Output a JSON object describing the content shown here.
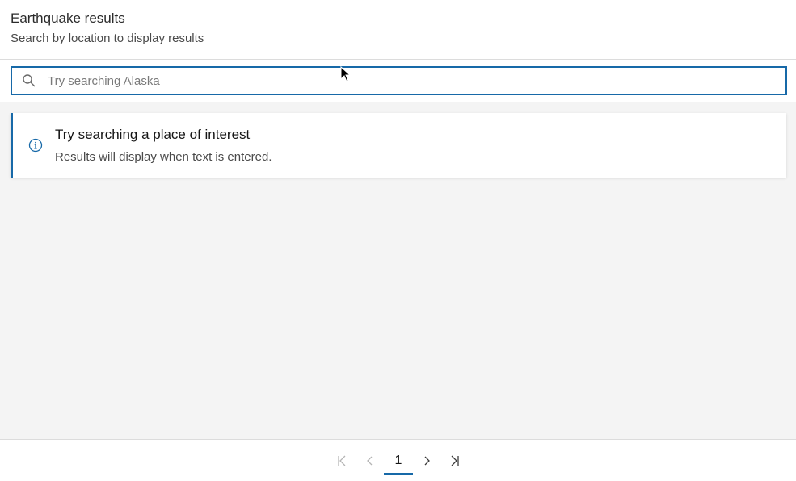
{
  "header": {
    "title": "Earthquake results",
    "subtitle": "Search by location to display results"
  },
  "search": {
    "placeholder": "Try searching Alaska",
    "value": "",
    "icon": "search-icon"
  },
  "notice": {
    "icon": "info-icon",
    "title": "Try searching a place of interest",
    "message": "Results will display when text is entered."
  },
  "pagination": {
    "current_page": "1",
    "first_icon": "chevron-first-icon",
    "prev_icon": "chevron-left-icon",
    "next_icon": "chevron-right-icon",
    "last_icon": "chevron-last-icon"
  },
  "colors": {
    "accent": "#1769a8",
    "background": "#f4f4f4",
    "surface": "#ffffff"
  }
}
